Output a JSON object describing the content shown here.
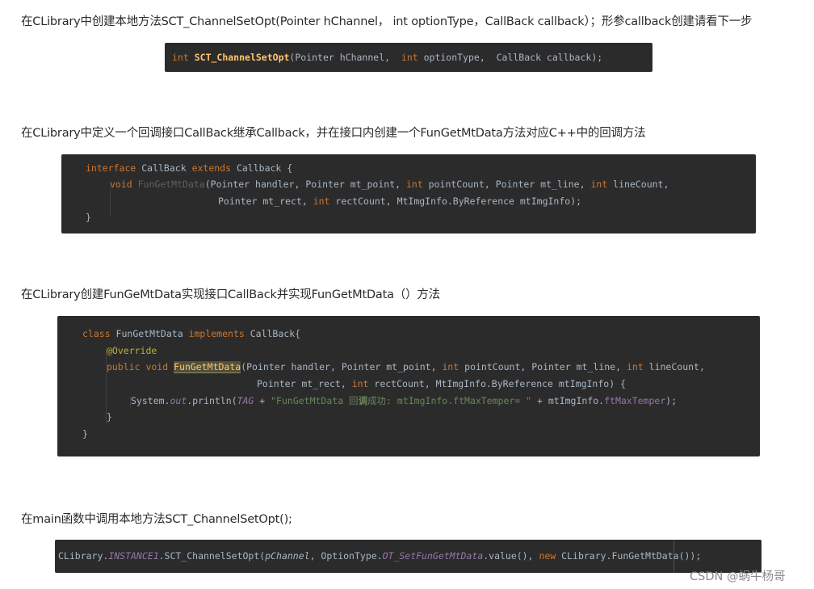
{
  "paragraphs": {
    "p1": "在CLibrary中创建本地方法SCT_ChannelSetOpt(Pointer hChannel，  int optionType，CallBack callback）；形参callback创建请看下一步",
    "p2": "在CLibrary中定义一个回调接口CallBack继承Callback，并在接口内创建一个FunGetMtData方法对应C++中的回调方法",
    "p3": "在CLibrary创建FunGeMtData实现接口CallBack并实现FunGetMtData（）方法",
    "p4": "在main函数中调用本地方法SCT_ChannelSetOpt();"
  },
  "code1": {
    "kw_int": "int",
    "fn": "SCT_ChannelSetOpt",
    "rest": "(Pointer hChannel,  ",
    "kw_int2": "int",
    "rest2": " optionType,  CallBack callback);"
  },
  "code2": {
    "l1_kw": "interface",
    "l1_name": " CallBack ",
    "l1_kw2": "extends",
    "l1_rest": " Callback {",
    "l2_kw": "void",
    "l2_fn": " FunGetMtData",
    "l2_a": "(Pointer handler, Pointer mt_point, ",
    "l2_int1": "int",
    "l2_b": " pointCount, Pointer mt_line, ",
    "l2_int2": "int",
    "l2_c": " lineCount,",
    "l3_a": "Pointer mt_rect, ",
    "l3_int": "int",
    "l3_b": " rectCount, MtImgInfo.ByReference mtImgInfo);",
    "l4": "}"
  },
  "code3": {
    "l1_kw": "class",
    "l1_name": " FunGetMtData ",
    "l1_kw2": "implements",
    "l1_rest": " CallBack{",
    "l2": "@Override",
    "l3_kw": "public void",
    "l3_fn": "FunGetMtData",
    "l3_a": "(Pointer handler, Pointer mt_point, ",
    "l3_int1": "int",
    "l3_b": " pointCount, Pointer mt_line, ",
    "l3_int2": "int",
    "l3_c": " lineCount,",
    "l4_a": "Pointer mt_rect, ",
    "l4_int": "int",
    "l4_b": " rectCount, MtImgInfo.ByReference mtImgInfo) {",
    "l5_a": "System.",
    "l5_out": "out",
    "l5_b": ".println(",
    "l5_tag": "TAG",
    "l5_c": " + ",
    "l5_str1": "\"FunGetMtData 回",
    "l5_strb": "调",
    "l5_str2": "成功: mtImgInfo.ftMaxTemper= \"",
    "l5_d": " + mtImgInfo.",
    "l5_field": "ftMaxTemper",
    "l5_e": ");",
    "l6": "}",
    "l7": "}"
  },
  "code4": {
    "a": "CLibrary.",
    "inst": "INSTANCE1",
    "b": ".SCT_ChannelSetOpt(",
    "param": "pChannel",
    "c": ", OptionType.",
    "opt": "OT_SetFunGetMtData",
    "d": ".value(), ",
    "kw_new": "new",
    "e": " CLibrary.FunGetMtData());"
  },
  "watermark": "CSDN @蜗牛杨哥"
}
